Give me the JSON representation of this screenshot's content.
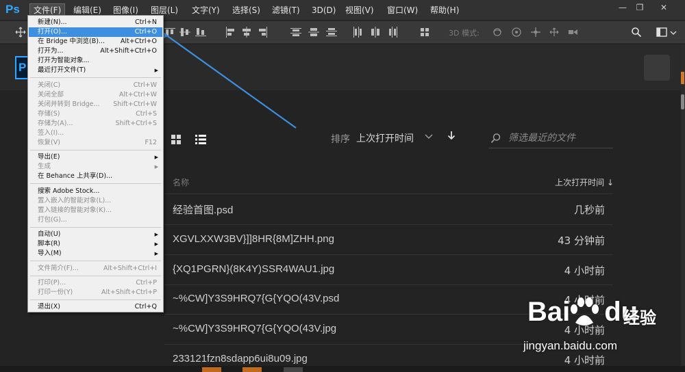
{
  "app": {
    "logo": "Ps",
    "home_logo": "P"
  },
  "menubar": {
    "items": [
      "文件(F)",
      "编辑(E)",
      "图像(I)",
      "图层(L)",
      "文字(Y)",
      "选择(S)",
      "滤镜(T)",
      "3D(D)",
      "视图(V)",
      "窗口(W)",
      "帮助(H)"
    ],
    "window_controls": {
      "minimize": "—",
      "restore": "❐",
      "close": "✕"
    }
  },
  "optbar": {
    "mode3d_label": "3D 模式:"
  },
  "file_menu": [
    {
      "label": "新建(N)...",
      "shortcut": "Ctrl+N"
    },
    {
      "label": "打开(O)...",
      "shortcut": "Ctrl+O"
    },
    {
      "label": "在 Bridge 中浏览(B)...",
      "shortcut": "Alt+Ctrl+O"
    },
    {
      "label": "打开为...",
      "shortcut": "Alt+Shift+Ctrl+O"
    },
    {
      "label": "打开为智能对象...",
      "shortcut": ""
    },
    {
      "label": "最近打开文件(T)",
      "shortcut": ""
    },
    {
      "label": "关闭(C)",
      "shortcut": "Ctrl+W"
    },
    {
      "label": "关闭全部",
      "shortcut": "Alt+Ctrl+W"
    },
    {
      "label": "关闭并转到 Bridge...",
      "shortcut": "Shift+Ctrl+W"
    },
    {
      "label": "存储(S)",
      "shortcut": "Ctrl+S"
    },
    {
      "label": "存储为(A)...",
      "shortcut": "Shift+Ctrl+S"
    },
    {
      "label": "签入(I)...",
      "shortcut": ""
    },
    {
      "label": "恢复(V)",
      "shortcut": "F12"
    },
    {
      "label": "导出(E)",
      "shortcut": ""
    },
    {
      "label": "生成",
      "shortcut": ""
    },
    {
      "label": "在 Behance 上共享(D)...",
      "shortcut": ""
    },
    {
      "label": "搜索 Adobe Stock...",
      "shortcut": ""
    },
    {
      "label": "置入嵌入的智能对象(L)...",
      "shortcut": ""
    },
    {
      "label": "置入链接的智能对象(K)...",
      "shortcut": ""
    },
    {
      "label": "打包(G)...",
      "shortcut": ""
    },
    {
      "label": "自动(U)",
      "shortcut": ""
    },
    {
      "label": "脚本(R)",
      "shortcut": ""
    },
    {
      "label": "导入(M)",
      "shortcut": ""
    },
    {
      "label": "文件简介(F)...",
      "shortcut": "Alt+Shift+Ctrl+I"
    },
    {
      "label": "打印(P)...",
      "shortcut": "Ctrl+P"
    },
    {
      "label": "打印一份(Y)",
      "shortcut": "Alt+Shift+Ctrl+P"
    },
    {
      "label": "退出(X)",
      "shortcut": "Ctrl+Q"
    }
  ],
  "home": {
    "sort_label": "排序",
    "sort_value": "上次打开时间",
    "filter_placeholder": "筛选最近的文件",
    "col_name": "名称",
    "col_time": "上次打开时间 ↓",
    "files": [
      {
        "name": "经验首图.psd",
        "time": "几秒前"
      },
      {
        "name": "XGVLXXW3BV}]]8HR{8M]ZHH.png",
        "time": "43 分钟前"
      },
      {
        "name": "{XQ1PGRN}(8K4Y)SSR4WAU1.jpg",
        "time": "4 小时前"
      },
      {
        "name": "~%CW]Y3S9HRQ7{G{YQO(43V.psd",
        "time": "4 小时前"
      },
      {
        "name": "~%CW]Y3S9HRQ7{G{YQO(43V.jpg",
        "time": "4 小时前"
      },
      {
        "name": "233121fzn8sdapp6ui8u09.jpg",
        "time": "4 小时前"
      }
    ]
  },
  "watermark": {
    "brand_a": "Bai",
    "brand_b": "du",
    "cn": "经验",
    "url": "jingyan.baidu.com"
  },
  "colors": {
    "accent": "#31a8ff",
    "highlight": "#3f8fe0",
    "background": "#232323"
  }
}
